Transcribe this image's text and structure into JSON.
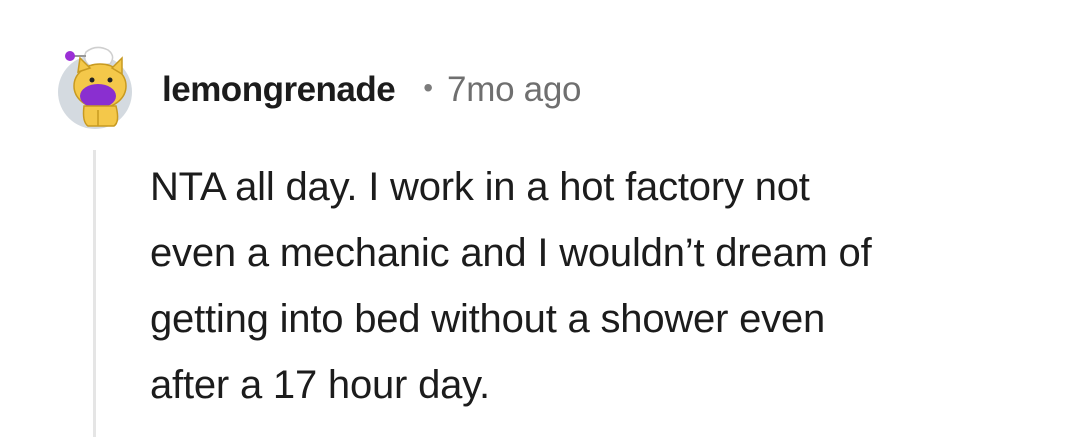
{
  "comment": {
    "avatar_icon": "snoo-cat-avatar-icon",
    "username": "lemongrenade",
    "separator": "•",
    "timestamp": "7mo ago",
    "body_lines": [
      "NTA all day. I work in a hot factory not",
      "even a mechanic and I wouldn’t dream of",
      "getting into bed without a shower even",
      "after a 17 hour day."
    ]
  },
  "colors": {
    "username": "#1c1c1c",
    "timestamp": "#6f6f6f",
    "thread_line": "#e5e5e5",
    "avatar_bg": "#d4dae0",
    "avatar_fur": "#f4c84a",
    "avatar_face": "#8a2fd0"
  }
}
